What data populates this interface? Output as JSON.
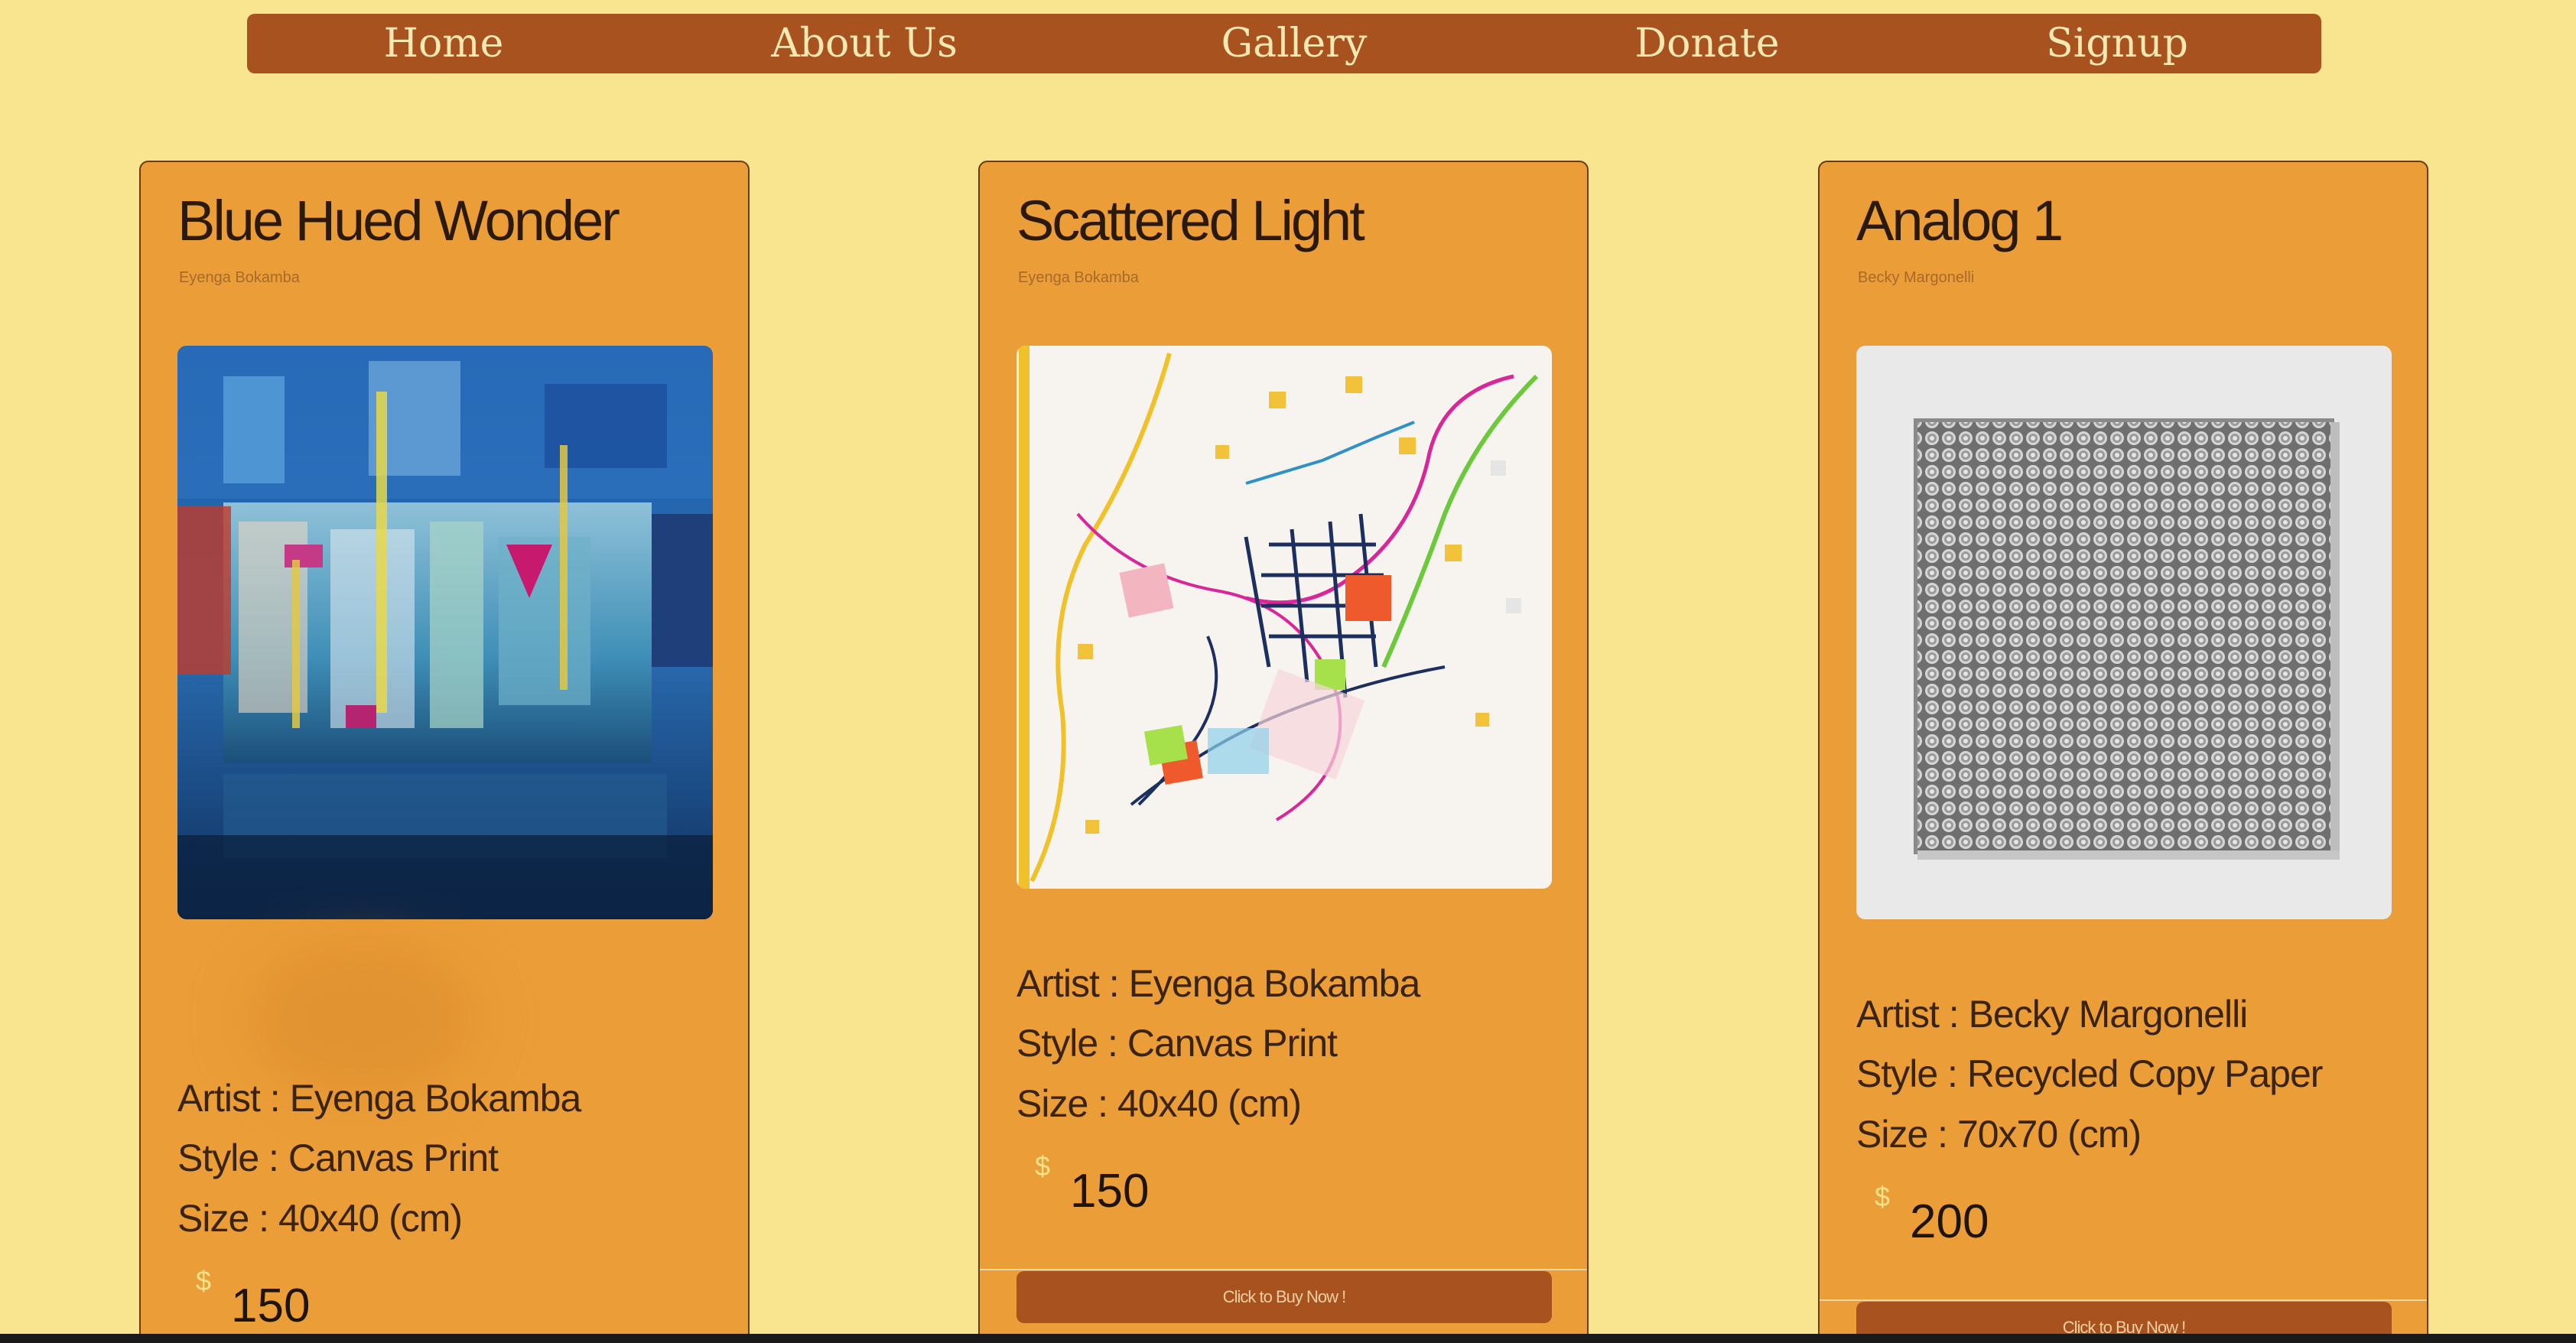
{
  "nav": {
    "items": [
      "Home",
      "About Us",
      "Gallery",
      "Donate",
      "Signup"
    ]
  },
  "cards": [
    {
      "title": "Blue Hued Wonder",
      "subtitle": "Eyenga Bokamba",
      "artist": "Artist : Eyenga Bokamba",
      "style": "Style : Canvas Print",
      "size": "Size : 40x40 (cm)",
      "currency": "$",
      "price": "150"
    },
    {
      "title": "Scattered Light",
      "subtitle": "Eyenga Bokamba",
      "artist": "Artist : Eyenga Bokamba",
      "style": "Style : Canvas Print",
      "size": "Size : 40x40 (cm)",
      "currency": "$",
      "price": "150",
      "buy_label": "Click to Buy Now !"
    },
    {
      "title": "Analog 1",
      "subtitle": "Becky Margonelli",
      "artist": "Artist : Becky Margonelli",
      "style": "Style : Recycled Copy Paper",
      "size": "Size : 70x70 (cm)",
      "currency": "$",
      "price": "200",
      "buy_label": "Click to Buy Now !"
    }
  ],
  "colors": {
    "page_bg": "#f9e58f",
    "nav_bg": "#a8531f",
    "card_bg": "#eb9d37",
    "button_bg": "#a8531f"
  }
}
